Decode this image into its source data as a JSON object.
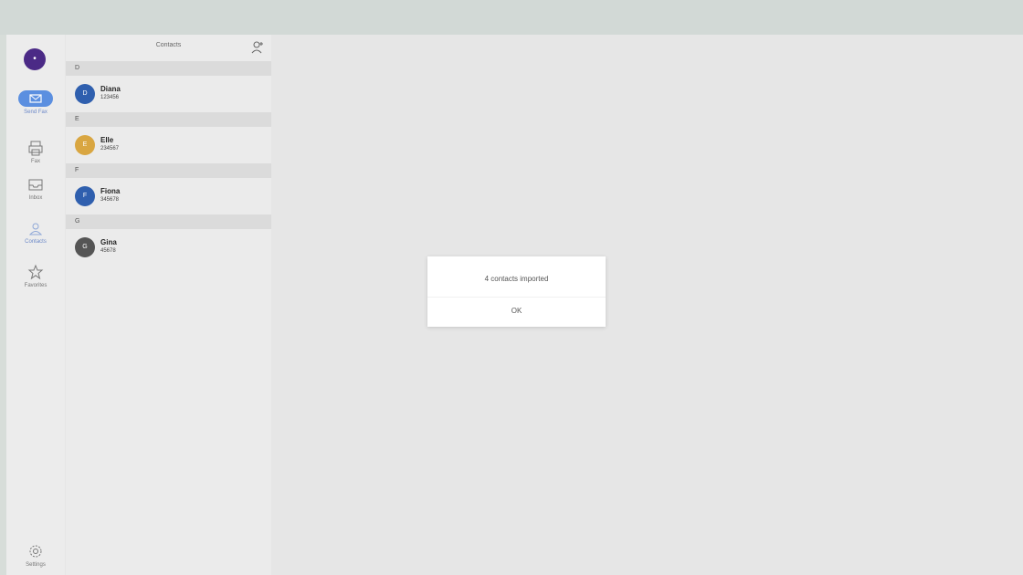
{
  "rail": {
    "avatar_initial": "•",
    "items": [
      {
        "label": "Send Fax",
        "icon": "send-fax-icon"
      },
      {
        "label": "Fax",
        "icon": "fax-machine-icon"
      },
      {
        "label": "Inbox",
        "icon": "inbox-icon"
      },
      {
        "label": "Contacts",
        "icon": "contacts-icon"
      },
      {
        "label": "Favorites",
        "icon": "star-icon"
      }
    ],
    "settings_label": "Settings"
  },
  "contacts": {
    "title": "Contacts",
    "sections": [
      {
        "letter": "D",
        "contacts": [
          {
            "name": "Diana",
            "number": "123456",
            "initials": "D",
            "color": "#2f5fae"
          }
        ]
      },
      {
        "letter": "E",
        "contacts": [
          {
            "name": "Elle",
            "number": "234567",
            "initials": "E",
            "color": "#d9a641"
          }
        ]
      },
      {
        "letter": "F",
        "contacts": [
          {
            "name": "Fiona",
            "number": "345678",
            "initials": "F",
            "color": "#2f5fae"
          }
        ]
      },
      {
        "letter": "G",
        "contacts": [
          {
            "name": "Gina",
            "number": "45678",
            "initials": "G",
            "color": "#555555"
          }
        ]
      }
    ]
  },
  "dialog": {
    "message": "4 contacts imported",
    "ok_label": "OK"
  }
}
